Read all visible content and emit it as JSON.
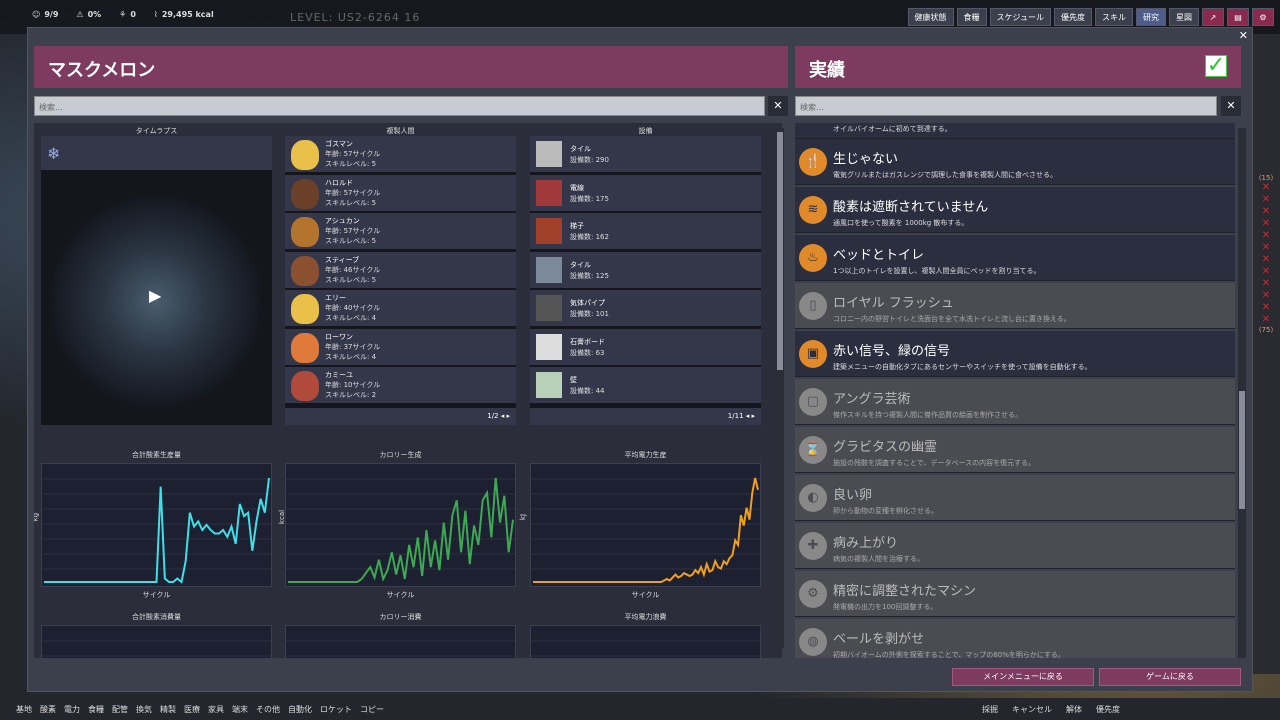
{
  "topbar": {
    "dupes": "9/9",
    "stress": "0%",
    "calories": "29,495 kcal",
    "critters": "0",
    "cycle": "LEVEL: US2-6264 16"
  },
  "mgmt": [
    "健康状態",
    "食糧",
    "スケジュール",
    "優先度",
    "スキル",
    "研究",
    "星図"
  ],
  "bottom": {
    "left": [
      "基地",
      "酸素",
      "電力",
      "食糧",
      "配管",
      "換気",
      "精製",
      "医療",
      "家具",
      "端末",
      "その他",
      "自動化",
      "ロケット",
      "コピー"
    ],
    "right": [
      "採掘",
      "キャンセル",
      "解体",
      "優先度"
    ]
  },
  "colony": {
    "title": "マスクメロン",
    "search_placeholder": "検索..."
  },
  "achievements": {
    "title": "実績",
    "search_placeholder": "検索..."
  },
  "columns": {
    "timelapse": "タイムラプス",
    "dupes": "複製人間",
    "buildings": "設備"
  },
  "dupes": [
    {
      "name": "ゴスマン",
      "age": "年齢: 57サイクル",
      "skill": "スキルレベル: 5",
      "color": "#e8c04a"
    },
    {
      "name": "ハロルド",
      "age": "年齢: 57サイクル",
      "skill": "スキルレベル: 5",
      "color": "#6a4028"
    },
    {
      "name": "アシュカン",
      "age": "年齢: 57サイクル",
      "skill": "スキルレベル: 5",
      "color": "#b5742e"
    },
    {
      "name": "スティーブ",
      "age": "年齢: 46サイクル",
      "skill": "スキルレベル: 5",
      "color": "#8a5030"
    },
    {
      "name": "エリー",
      "age": "年齢: 40サイクル",
      "skill": "スキルレベル: 4",
      "color": "#e8c04a"
    },
    {
      "name": "ローワン",
      "age": "年齢: 37サイクル",
      "skill": "スキルレベル: 4",
      "color": "#e07a3a"
    },
    {
      "name": "カミーユ",
      "age": "年齢: 10サイクル",
      "skill": "スキルレベル: 2",
      "color": "#b04a3a"
    }
  ],
  "dupes_pager": "1/2 ◂ ▸",
  "buildings": [
    {
      "name": "タイル",
      "count": "設備数: 290",
      "color": "#bbb"
    },
    {
      "name": "電線",
      "count": "設備数: 175",
      "color": "#a03a3a"
    },
    {
      "name": "梯子",
      "count": "設備数: 162",
      "color": "#a0402a"
    },
    {
      "name": "タイル",
      "count": "設備数: 125",
      "color": "#7a8a9a"
    },
    {
      "name": "気体パイプ",
      "count": "設備数: 101",
      "color": "#555"
    },
    {
      "name": "石膏ボード",
      "count": "設備数: 63",
      "color": "#ddd"
    },
    {
      "name": "壁",
      "count": "設備数: 44",
      "color": "#b8d0b8"
    }
  ],
  "buildings_pager": "1/11 ◂ ▸",
  "chart_data": [
    {
      "type": "line",
      "title": "合計酸素生産量",
      "xlabel": "サイクル",
      "ylabel": "kg",
      "color": "#3ee0e8",
      "values": [
        0,
        0,
        0,
        0,
        0,
        0,
        0,
        0,
        0,
        0,
        0,
        0,
        0,
        0,
        0,
        0,
        0,
        0,
        0,
        0,
        0,
        0,
        0,
        0,
        0,
        0,
        0,
        0,
        55,
        2,
        0,
        0,
        2,
        0,
        12,
        40,
        32,
        35,
        30,
        33,
        30,
        28,
        28,
        30,
        26,
        32,
        22,
        45,
        38,
        40,
        18,
        35,
        48,
        40,
        60
      ]
    },
    {
      "type": "line",
      "title": "カロリー生成",
      "xlabel": "サイクル",
      "ylabel": "kcal",
      "color": "#3ea852",
      "values": [
        0,
        0,
        0,
        0,
        0,
        0,
        0,
        0,
        0,
        0,
        0,
        0,
        0,
        0,
        0,
        0,
        0,
        2,
        6,
        10,
        3,
        15,
        2,
        8,
        20,
        5,
        18,
        2,
        25,
        10,
        30,
        4,
        35,
        10,
        28,
        8,
        40,
        15,
        45,
        55,
        20,
        48,
        12,
        38,
        25,
        55,
        60,
        30,
        70,
        40,
        58,
        20,
        42
      ]
    },
    {
      "type": "line",
      "title": "平均電力生産",
      "xlabel": "サイクル",
      "ylabel": "kJ",
      "color": "#f0a020",
      "values": [
        0,
        0,
        0,
        0,
        0,
        0,
        0,
        0,
        0,
        0,
        0,
        0,
        0,
        0,
        0,
        0,
        0,
        0,
        0,
        0,
        0,
        0,
        0,
        0,
        0,
        0,
        0,
        0,
        0,
        0,
        0,
        0,
        0,
        0,
        0,
        0,
        0,
        0,
        0,
        0,
        0,
        0,
        0,
        0,
        0,
        0,
        1,
        2,
        1,
        3,
        5,
        3,
        4,
        6,
        5,
        4,
        5,
        8,
        6,
        10,
        5,
        12,
        7,
        8,
        14,
        10,
        9,
        14,
        12,
        16,
        18,
        28,
        25,
        45,
        38,
        50,
        42,
        60,
        70,
        62
      ]
    },
    {
      "type": "line",
      "title": "合計酸素消費量",
      "color": "#3ee0e8"
    },
    {
      "type": "line",
      "title": "カロリー消費",
      "color": "#3ea852"
    },
    {
      "type": "line",
      "title": "平均電力浪費",
      "color": "#e03050"
    }
  ],
  "ach_top_desc": "オイルバイオームに初めて到達する。",
  "ach": [
    {
      "name": "生じゃない",
      "desc": "電気グリルまたはガスレンジで調理した食事を複製人間に食べさせる。",
      "done": true,
      "icon": "🍴"
    },
    {
      "name": "酸素は遮断されていません",
      "desc": "通風口を使って酸素を 1000kg 散布する。",
      "done": true,
      "icon": "≋"
    },
    {
      "name": "ベッドとトイレ",
      "desc": "1つ以上のトイレを設置し、複製人間全員にベッドを割り当てる。",
      "done": true,
      "icon": "♨"
    },
    {
      "name": "ロイヤル フラッシュ",
      "desc": "コロニー内の野営トイレと洗面台を全て水洗トイレと流し台に置き換える。",
      "done": false,
      "icon": "▯"
    },
    {
      "name": "赤い信号、緑の信号",
      "desc": "建築メニューの自動化タブにあるセンサーやスイッチを使って設備を自動化する。",
      "done": true,
      "icon": "▣"
    },
    {
      "name": "アングラ芸術",
      "desc": "傑作スキルを持つ複製人間に傑作品質の絵画を制作させる。",
      "done": false,
      "icon": "▢"
    },
    {
      "name": "グラビタスの幽霊",
      "desc": "施設の残骸を調査することで、データベースの内容を復元する。",
      "done": false,
      "icon": "⌛"
    },
    {
      "name": "良い卵",
      "desc": "卵から動物の変種を孵化させる。",
      "done": false,
      "icon": "◐"
    },
    {
      "name": "病み上がり",
      "desc": "病気の複製人間を治療する。",
      "done": false,
      "icon": "✚"
    },
    {
      "name": "精密に調整されたマシン",
      "desc": "発電機の出力を100回調整する。",
      "done": false,
      "icon": "⚙"
    },
    {
      "name": "ベールを剥がせ",
      "desc": "初期バイオームの外側を探索することで、マップの80%を明らかにする。",
      "done": false,
      "icon": "◍"
    }
  ],
  "footer": {
    "main_menu": "メインメニューに戻る",
    "resume": "ゲームに戻る"
  }
}
